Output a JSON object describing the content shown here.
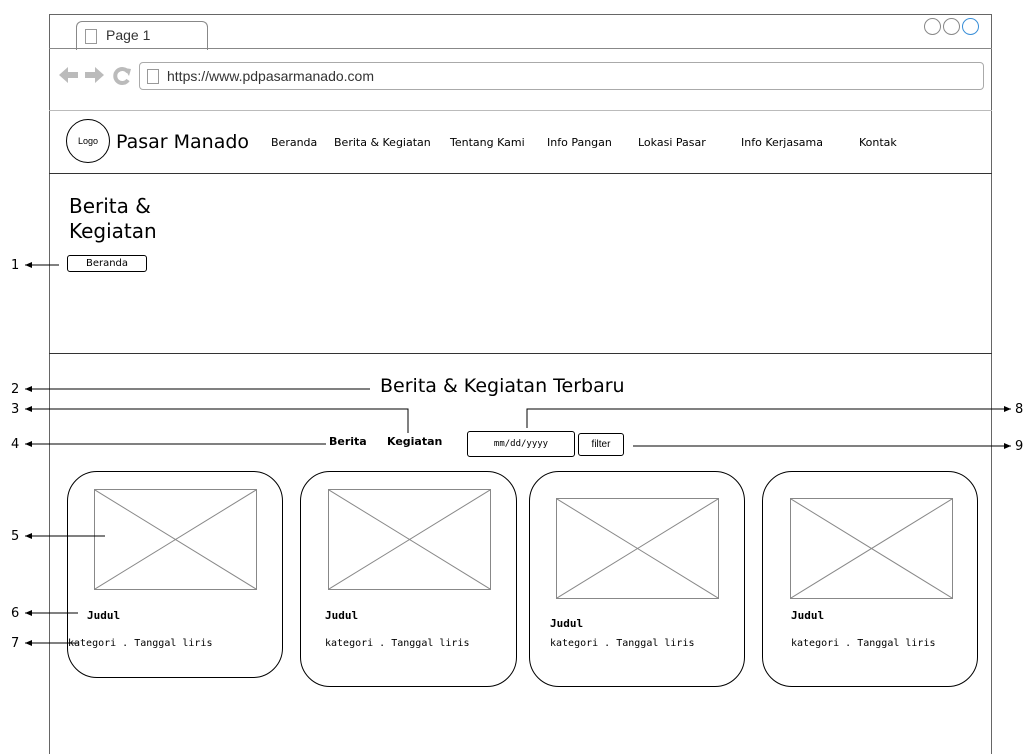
{
  "browser": {
    "tab_title": "Page 1",
    "url": "https://www.pdpasarmanado.com"
  },
  "nav": {
    "logo_label": "Logo",
    "site_name": "Pasar Manado",
    "items": [
      "Beranda",
      "Berita & Kegiatan",
      "Tentang Kami",
      "Info Pangan",
      "Lokasi Pasar",
      "Info Kerjasama",
      "Kontak"
    ]
  },
  "hero": {
    "title_line1": "Berita &",
    "title_line2": "Kegiatan",
    "breadcrumb": "Beranda"
  },
  "section": {
    "title": "Berita & Kegiatan Terbaru",
    "filter_tabs": [
      "Berita",
      "Kegiatan"
    ],
    "date_placeholder": "mm/dd/yyyy",
    "filter_button": "filter"
  },
  "cards": [
    {
      "title": "Judul",
      "meta": "kategori . Tanggal liris"
    },
    {
      "title": "Judul",
      "meta": "kategori . Tanggal liris"
    },
    {
      "title": "Judul",
      "meta": "kategori . Tanggal liris"
    },
    {
      "title": "Judul",
      "meta": "kategori . Tanggal liris"
    }
  ],
  "annotations": [
    "1",
    "2",
    "3",
    "4",
    "5",
    "6",
    "7",
    "8",
    "9"
  ]
}
